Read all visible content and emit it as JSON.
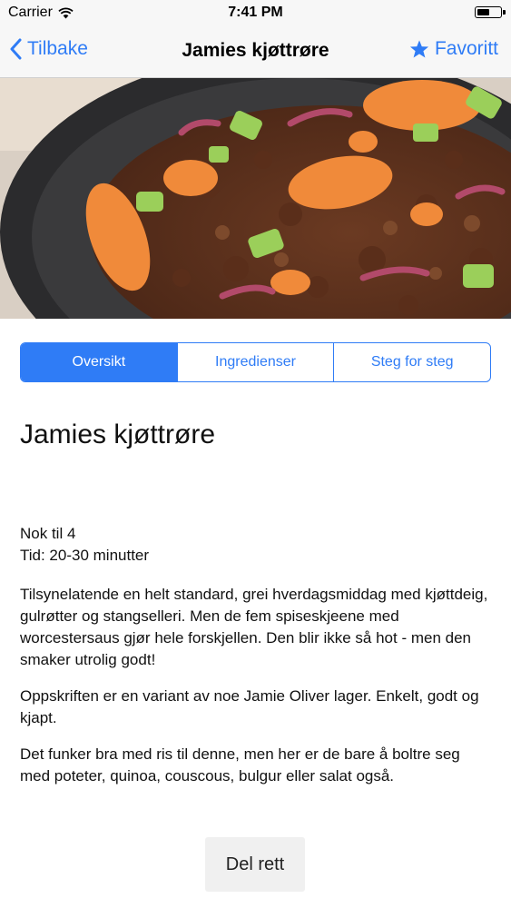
{
  "status_bar": {
    "carrier": "Carrier",
    "time": "7:41 PM"
  },
  "nav": {
    "back_label": "Tilbake",
    "title": "Jamies kjøttrøre",
    "favorite_label": "Favoritt"
  },
  "tabs": [
    {
      "label": "Oversikt",
      "active": true
    },
    {
      "label": "Ingredienser",
      "active": false
    },
    {
      "label": "Steg for steg",
      "active": false
    }
  ],
  "recipe": {
    "title": "Jamies kjøttrøre",
    "servings": "Nok til 4",
    "time": "Tid: 20-30 minutter",
    "paragraphs": [
      "Tilsynelatende en helt standard, grei hverdagsmiddag med kjøttdeig, gulrøtter og stangselleri. Men de fem spiseskjeene med worcestersaus gjør hele forskjellen. Den blir ikke så hot - men den smaker utrolig godt!",
      "Oppskriften er en variant av noe Jamie Oliver lager.  Enkelt, godt og kjapt.",
      "Det funker bra med ris til denne, men her er de bare å boltre seg med poteter, quinoa, couscous, bulgur eller salat også."
    ]
  },
  "share_label": "Del rett",
  "colors": {
    "accent": "#2f7cf6",
    "bar_background": "#f7f7f7"
  },
  "icons": {
    "wifi": "wifi-icon",
    "back": "chevron-left-icon",
    "favorite": "star-icon",
    "battery": "battery-icon"
  }
}
